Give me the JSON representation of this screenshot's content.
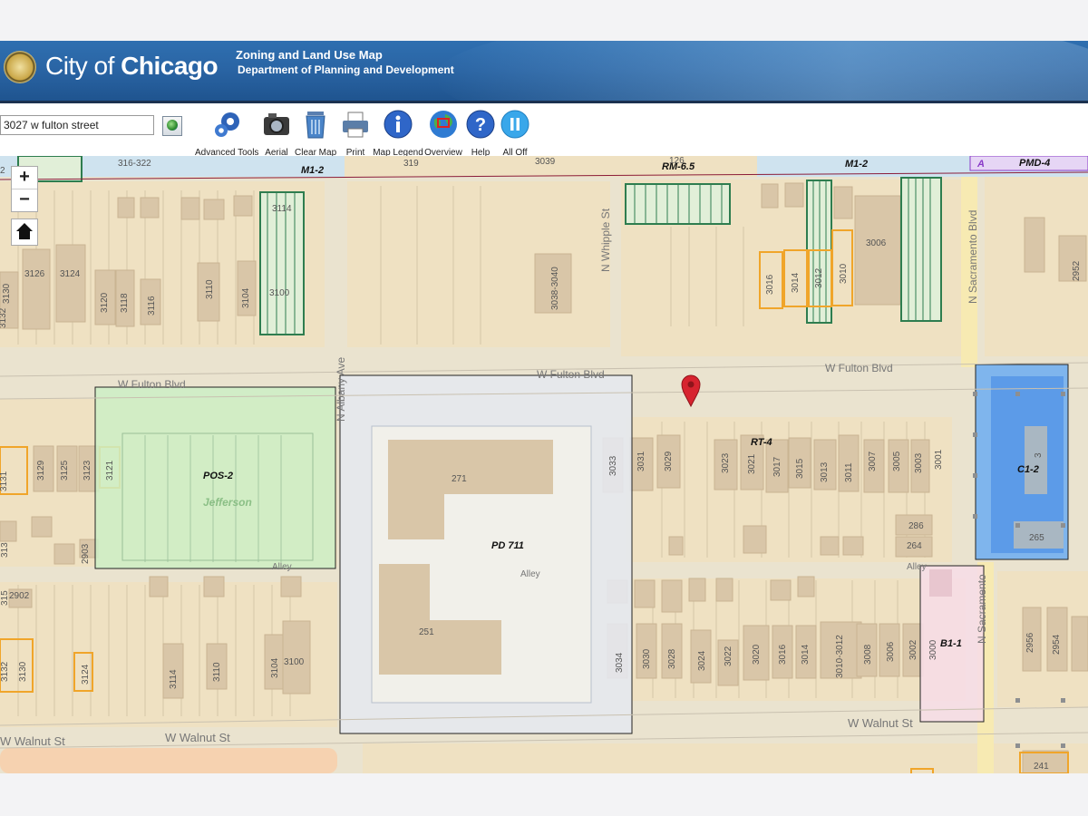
{
  "header": {
    "city_prefix": "City of",
    "city_name": "Chicago",
    "line1": "Zoning and Land Use Map",
    "line2": "Department of Planning and Development"
  },
  "search": {
    "value": "3027 w fulton street"
  },
  "toolbar": [
    {
      "label": "Advanced Tools",
      "icon": "gears-icon"
    },
    {
      "label": "Aerial",
      "icon": "camera-icon"
    },
    {
      "label": "Clear Map",
      "icon": "trash-icon"
    },
    {
      "label": "Print",
      "icon": "printer-icon"
    },
    {
      "label": "Map Legend",
      "icon": "info-icon"
    },
    {
      "label": "Overview",
      "icon": "globe-icon"
    },
    {
      "label": "Help",
      "icon": "help-icon"
    },
    {
      "label": "All Off",
      "icon": "pause-icon"
    }
  ],
  "map": {
    "streets": {
      "fulton_left": "W Fulton Blvd",
      "fulton_mid": "W Fulton Blvd",
      "fulton_right": "W Fulton Blvd",
      "walnut_left": "W Walnut St",
      "walnut_mid": "W Walnut St",
      "walnut_right": "W Walnut St",
      "albany": "N Albany Ave",
      "whipple": "N Whipple St",
      "sacramento": "N Sacramento Blvd",
      "sacramento_lower": "N Sacramento",
      "alley_left": "Alley",
      "alley_mid": "Alley",
      "alley_right": "Alley"
    },
    "zones": {
      "m1_left": "M1-2",
      "rm65": "RM-6.5",
      "m1_right": "M1-2",
      "pmd": "PMD-4",
      "pmd_a": "A",
      "pos2": "POS-2",
      "park": "Jefferson",
      "pd": "PD 711",
      "rt4": "RT-4",
      "c12": "C1-2",
      "b11": "B1-1"
    },
    "addresses": {
      "top": [
        "2",
        "316-322",
        "319",
        "3039",
        "126",
        "3114",
        "3126",
        "3124",
        "3120",
        "3118",
        "3116",
        "3110",
        "3104",
        "3100",
        "3130",
        "3132",
        "3038-3040",
        "3016",
        "3014",
        "3012",
        "3010",
        "3006",
        "2952"
      ],
      "middle": [
        "3131",
        "3129",
        "3125",
        "3123",
        "3121",
        "2903",
        "313",
        "271",
        "3033",
        "3031",
        "3029",
        "3023",
        "3021",
        "3017",
        "3015",
        "3013",
        "3011",
        "3007",
        "3005",
        "3003",
        "3001",
        "286",
        "264",
        "3",
        "265"
      ],
      "bottom": [
        "2902",
        "315",
        "3132",
        "3130",
        "3124",
        "3114",
        "3110",
        "3104",
        "3100",
        "251",
        "3034",
        "3030",
        "3028",
        "3024",
        "3022",
        "3020",
        "3016",
        "3014",
        "3010-3012",
        "3008",
        "3006",
        "3002",
        "3000",
        "2956",
        "2954",
        "241"
      ]
    }
  },
  "colors": {
    "header": "#2a65a5",
    "parcel": "#efe1c2",
    "building": "#d9c6a8",
    "park": "#ccefc5",
    "pd": "#e5e8ef",
    "c12": "#73aff0",
    "b11": "#f6dde6",
    "pin": "#d7232f",
    "historic": "#2e7d4f",
    "landmark": "#f0a52a"
  }
}
